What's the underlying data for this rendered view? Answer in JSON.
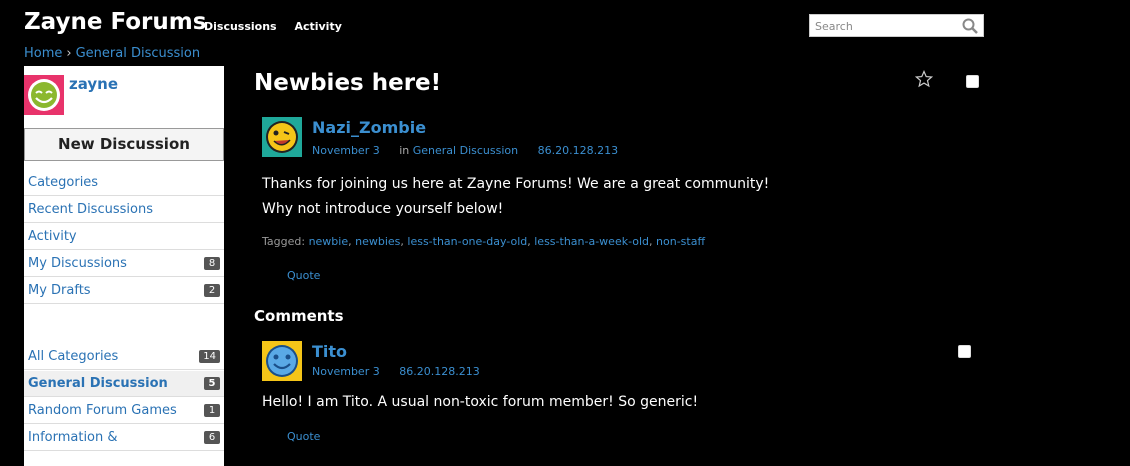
{
  "site": {
    "brand": "Zayne Forums",
    "nav": [
      "Discussions",
      "Activity"
    ]
  },
  "search": {
    "placeholder": "Search"
  },
  "breadcrumb": {
    "home": "Home",
    "sep": "›",
    "current": "General Discussion"
  },
  "sidebar": {
    "username": "zayne",
    "new_discussion": "New Discussion",
    "nav": [
      {
        "label": "Categories",
        "count": ""
      },
      {
        "label": "Recent Discussions",
        "count": ""
      },
      {
        "label": "Activity",
        "count": ""
      },
      {
        "label": "My Discussions",
        "count": "8"
      },
      {
        "label": "My Drafts",
        "count": "2"
      }
    ],
    "categories": [
      {
        "label": "All Categories",
        "count": "14"
      },
      {
        "label": "General Discussion",
        "count": "5"
      },
      {
        "label": "Random Forum Games",
        "count": "1"
      },
      {
        "label": "Information &",
        "count": "6"
      }
    ]
  },
  "discussion": {
    "title": "Newbies here!",
    "author": "Nazi_Zombie",
    "date": "November 3",
    "in_label": "in",
    "category": "General Discussion",
    "ip": "86.20.128.213",
    "body_line1": "Thanks for joining us here at Zayne Forums! We are a great community!",
    "body_line2": "Why not introduce yourself below!",
    "tagged_label": "Tagged:",
    "tags": [
      "newbie",
      "newbies",
      "less-than-one-day-old",
      "less-than-a-week-old",
      "non-staff"
    ],
    "quote": "Quote"
  },
  "comments": {
    "heading": "Comments",
    "items": [
      {
        "author": "Tito",
        "date": "November 3",
        "ip": "86.20.128.213",
        "body": "Hello! I am Tito. A usual non-toxic forum member! So generic!",
        "quote": "Quote"
      }
    ]
  },
  "colors": {
    "link": "#3b8fd0",
    "background": "#000000",
    "sidebar_bg": "#ffffff"
  }
}
